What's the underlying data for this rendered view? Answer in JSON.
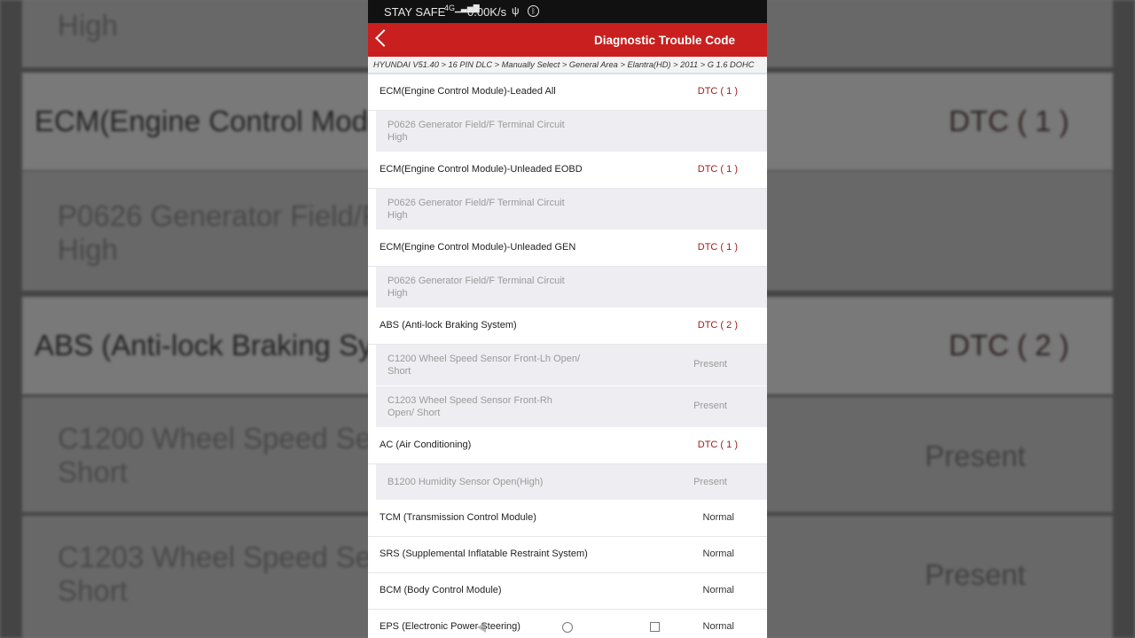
{
  "status_bar": {
    "carrier": "STAY SAFE",
    "signal": "4G",
    "speed": "0.00K/s"
  },
  "app_bar": {
    "title": "Diagnostic Trouble Code",
    "back_icon": "chevron-left-icon"
  },
  "breadcrumb": "HYUNDAI V51.40 > 16 PIN DLC > Manually Select > General Area > Elantra(HD) > 2011 > G 1.6 DOHC",
  "systems": [
    {
      "name": "ECM(Engine Control Module)-Leaded All",
      "status": "DTC ( 1 )",
      "codes": [
        {
          "text": "P0626 Generator Field/F Terminal Circuit High",
          "state": ""
        }
      ]
    },
    {
      "name": "ECM(Engine Control Module)-Unleaded EOBD",
      "status": "DTC ( 1 )",
      "codes": [
        {
          "text": "P0626 Generator Field/F Terminal Circuit High",
          "state": ""
        }
      ]
    },
    {
      "name": "ECM(Engine Control Module)-Unleaded GEN",
      "status": "DTC ( 1 )",
      "codes": [
        {
          "text": "P0626 Generator Field/F Terminal Circuit High",
          "state": ""
        }
      ]
    },
    {
      "name": "ABS (Anti-lock Braking System)",
      "status": "DTC ( 2 )",
      "codes": [
        {
          "text": "C1200 Wheel Speed Sensor Front-Lh Open/ Short",
          "state": "Present"
        },
        {
          "text": "C1203 Wheel Speed Sensor Front-Rh Open/ Short",
          "state": "Present"
        }
      ]
    },
    {
      "name": "AC (Air Conditioning)",
      "status": "DTC ( 1 )",
      "codes": [
        {
          "text": "B1200 Humidity Sensor Open(High)",
          "state": "Present"
        }
      ]
    },
    {
      "name": "TCM (Transmission Control Module)",
      "status": "Normal",
      "codes": []
    },
    {
      "name": "SRS (Supplemental Inflatable Restraint System)",
      "status": "Normal",
      "codes": []
    },
    {
      "name": "BCM (Body Control Module)",
      "status": "Normal",
      "codes": []
    },
    {
      "name": "EPS (Electronic Power Steering)",
      "status": "Normal",
      "codes": []
    }
  ],
  "background_mirror": {
    "top_sub": "High",
    "head1": "ECM(Engine Control Module)",
    "head1_status": "DTC ( 1 )",
    "sub1": "P0626 Generator Field/F",
    "sub1b": "High",
    "head2": "ABS (Anti-lock Braking Syste",
    "head2_status": "DTC ( 2 )",
    "sub2": "C1200 Wheel Speed Sen",
    "sub2b": "Short",
    "sub2_state": "Present",
    "sub3": "C1203 Wheel Speed Sen",
    "sub3b": "Short",
    "sub3_state": "Present"
  },
  "colors": {
    "accent": "#c91f1f",
    "dtc_text": "#9b1a1a"
  }
}
